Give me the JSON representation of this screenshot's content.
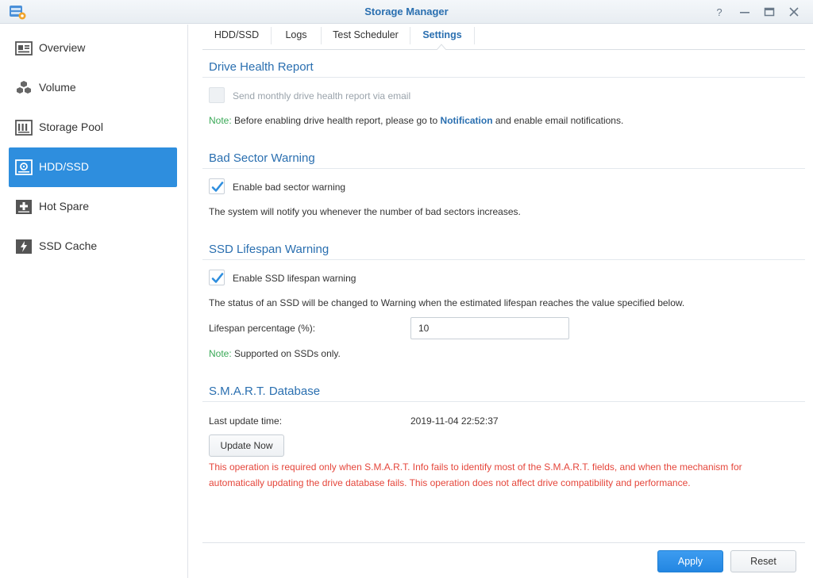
{
  "window": {
    "title": "Storage Manager",
    "controls": [
      "help",
      "minimize",
      "maximize",
      "close"
    ]
  },
  "sidebar": {
    "items": [
      {
        "label": "Overview",
        "icon": "overview-icon",
        "active": false
      },
      {
        "label": "Volume",
        "icon": "volume-cubes-icon",
        "active": false
      },
      {
        "label": "Storage Pool",
        "icon": "storage-pool-icon",
        "active": false
      },
      {
        "label": "HDD/SSD",
        "icon": "hdd-icon",
        "active": true
      },
      {
        "label": "Hot Spare",
        "icon": "hot-spare-plus-icon",
        "active": false
      },
      {
        "label": "SSD Cache",
        "icon": "ssd-cache-bolt-icon",
        "active": false
      }
    ]
  },
  "tabs": [
    {
      "label": "HDD/SSD",
      "active": false
    },
    {
      "label": "Logs",
      "active": false
    },
    {
      "label": "Test Scheduler",
      "active": false
    },
    {
      "label": "Settings",
      "active": true
    }
  ],
  "drive_health": {
    "title": "Drive Health Report",
    "checkbox_label": "Send monthly drive health report via email",
    "checked": false,
    "enabled": false,
    "note_label": "Note:",
    "note_pre": " Before enabling drive health report, please go to ",
    "note_link": "Notification",
    "note_post": " and enable email notifications."
  },
  "bad_sector": {
    "title": "Bad Sector Warning",
    "checkbox_label": "Enable bad sector warning",
    "checked": true,
    "description": "The system will notify you whenever the number of bad sectors increases."
  },
  "ssd_lifespan": {
    "title": "SSD Lifespan Warning",
    "checkbox_label": "Enable SSD lifespan warning",
    "checked": true,
    "description": "The status of an SSD will be changed to Warning when the estimated lifespan reaches the value specified below.",
    "field_label": "Lifespan percentage (%):",
    "field_value": "10",
    "note_label": "Note:",
    "note_text": " Supported on SSDs only."
  },
  "smart_db": {
    "title": "S.M.A.R.T. Database",
    "last_update_label": "Last update time:",
    "last_update_value": "2019-11-04 22:52:37",
    "update_button": "Update Now",
    "warning": "This operation is required only when S.M.A.R.T. Info fails to identify most of the S.M.A.R.T. fields, and when the mechanism for automatically updating the drive database fails. This operation does not affect drive compatibility and performance."
  },
  "footer": {
    "apply": "Apply",
    "reset": "Reset"
  },
  "colors": {
    "accent": "#2e8ede",
    "title_blue": "#2a6fb0",
    "note_green": "#3aa957",
    "warning_red": "#e5463b"
  }
}
